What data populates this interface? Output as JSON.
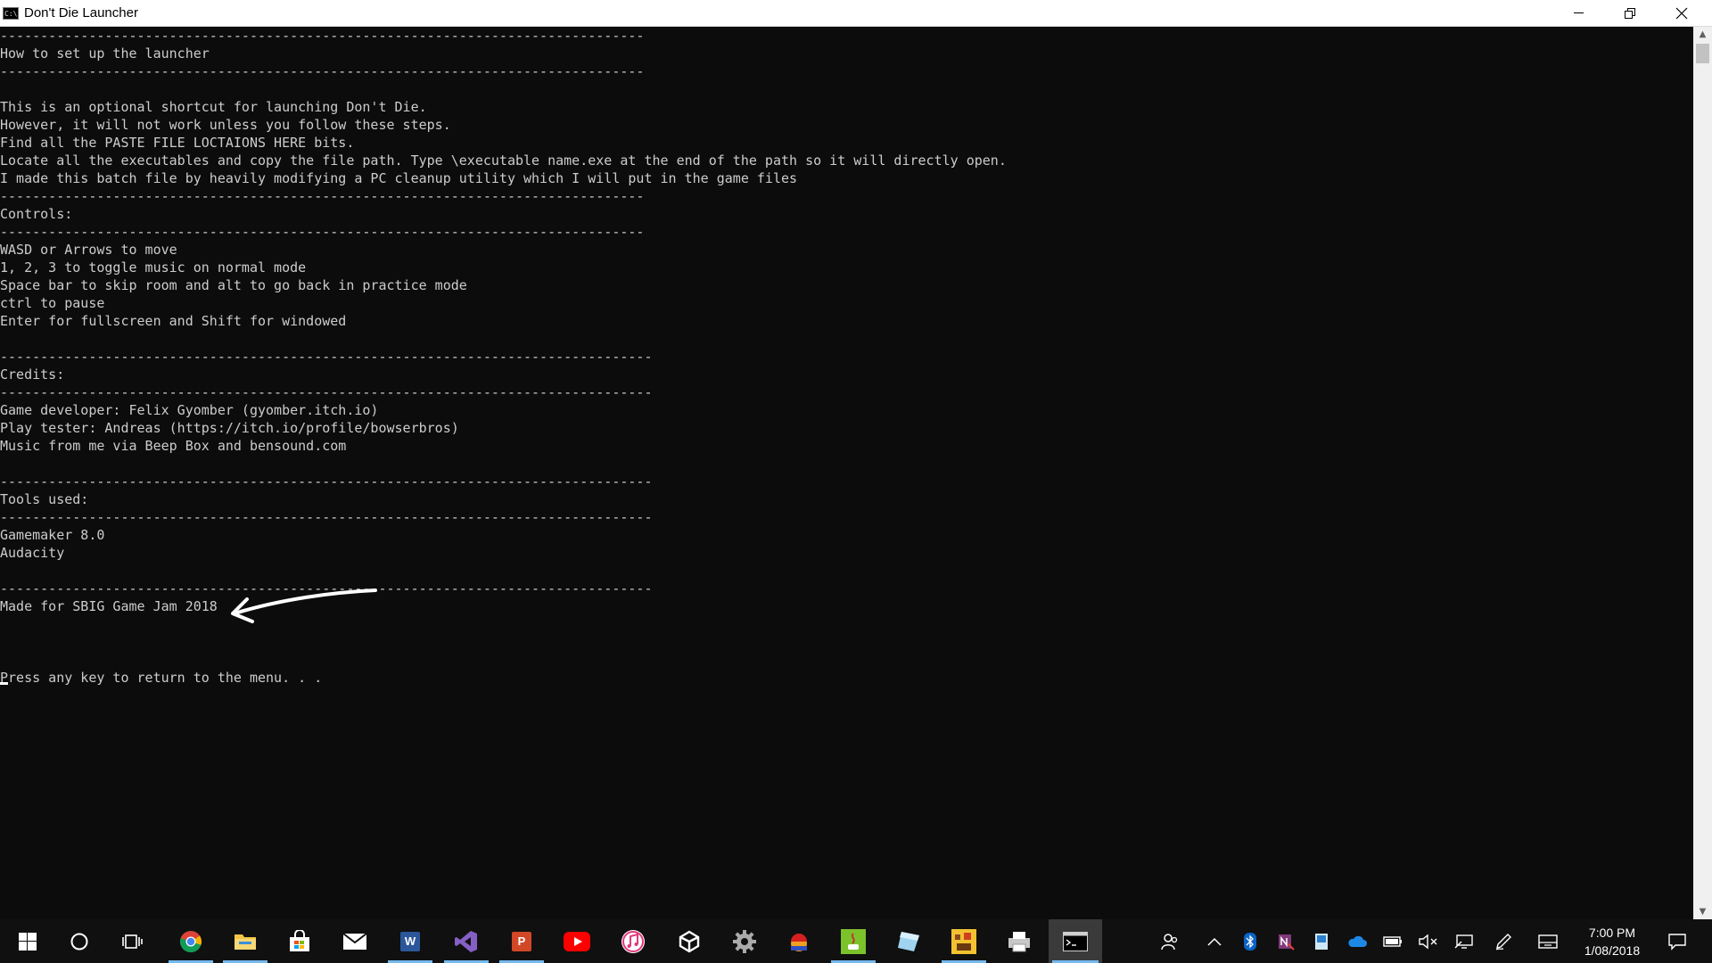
{
  "window": {
    "title": "Don't Die Launcher",
    "app_icon_text": "C:\\"
  },
  "console": {
    "lines": [
      "--------------------------------------------------------------------------------",
      "How to set up the launcher",
      "--------------------------------------------------------------------------------",
      "",
      "This is an optional shortcut for launching Don't Die.",
      "However, it will not work unless you follow these steps.",
      "Find all the PASTE FILE LOCTAIONS HERE bits.",
      "Locate all the executables and copy the file path. Type \\executable name.exe at the end of the path so it will directly open.",
      "I made this batch file by heavily modifying a PC cleanup utility which I will put in the game files",
      "--------------------------------------------------------------------------------",
      "Controls:",
      "--------------------------------------------------------------------------------",
      "WASD or Arrows to move",
      "1, 2, 3 to toggle music on normal mode",
      "Space bar to skip room and alt to go back in practice mode",
      "ctrl to pause",
      "Enter for fullscreen and Shift for windowed",
      "",
      "---------------------------------------------------------------------------------",
      "Credits:",
      "---------------------------------------------------------------------------------",
      "Game developer: Felix Gyomber (gyomber.itch.io)",
      "Play tester: Andreas (https://itch.io/profile/bowserbros)",
      "Music from me via Beep Box and bensound.com",
      "",
      "---------------------------------------------------------------------------------",
      "Tools used:",
      "---------------------------------------------------------------------------------",
      "Gamemaker 8.0",
      "Audacity",
      "",
      "---------------------------------------------------------------------------------",
      "Made for SBIG Game Jam 2018",
      "",
      "",
      "",
      "Press any key to return to the menu. . ."
    ]
  },
  "taskbar": {
    "apps": [
      {
        "name": "start-button",
        "icon": "windows-logo-icon"
      },
      {
        "name": "cortana-button",
        "icon": "cortana-circle-icon"
      },
      {
        "name": "task-view-button",
        "icon": "task-view-icon"
      },
      {
        "name": "chrome-app",
        "icon": "chrome-icon"
      },
      {
        "name": "file-explorer-app",
        "icon": "folder-icon"
      },
      {
        "name": "store-app",
        "icon": "store-bag-icon"
      },
      {
        "name": "mail-app",
        "icon": "mail-envelope-icon"
      },
      {
        "name": "word-app",
        "icon": "word-icon",
        "letter": "W"
      },
      {
        "name": "visual-studio-app",
        "icon": "visual-studio-icon"
      },
      {
        "name": "powerpoint-app",
        "icon": "powerpoint-icon",
        "letter": "P"
      },
      {
        "name": "youtube-app",
        "icon": "youtube-play-icon"
      },
      {
        "name": "itunes-app",
        "icon": "music-note-icon"
      },
      {
        "name": "unity-app",
        "icon": "unity-icon"
      },
      {
        "name": "settings-app",
        "icon": "gear-icon"
      },
      {
        "name": "game-app",
        "icon": "game-character-icon"
      },
      {
        "name": "java-app",
        "icon": "java-icon"
      },
      {
        "name": "notes-app",
        "icon": "paper-note-icon"
      },
      {
        "name": "game-jam-app",
        "icon": "game-tile-icon"
      },
      {
        "name": "printer-app",
        "icon": "printer-icon"
      },
      {
        "name": "command-prompt-app",
        "icon": "command-prompt-icon"
      }
    ],
    "tray": [
      {
        "name": "people-icon"
      },
      {
        "name": "chevron-up-icon"
      },
      {
        "name": "bluetooth-icon"
      },
      {
        "name": "onenote-tray-icon"
      },
      {
        "name": "device-tray-icon"
      },
      {
        "name": "onedrive-cloud-icon"
      },
      {
        "name": "battery-icon"
      },
      {
        "name": "volume-muted-icon"
      },
      {
        "name": "network-icon"
      },
      {
        "name": "pen-icon"
      },
      {
        "name": "touch-keyboard-icon"
      }
    ],
    "clock": {
      "time": "7:00 PM",
      "date": "1/08/2018"
    }
  },
  "colors": {
    "console_bg": "#0c0c0c",
    "console_text": "#cccccc",
    "taskbar_bg": "#101010",
    "accent": "#76b9ed"
  }
}
